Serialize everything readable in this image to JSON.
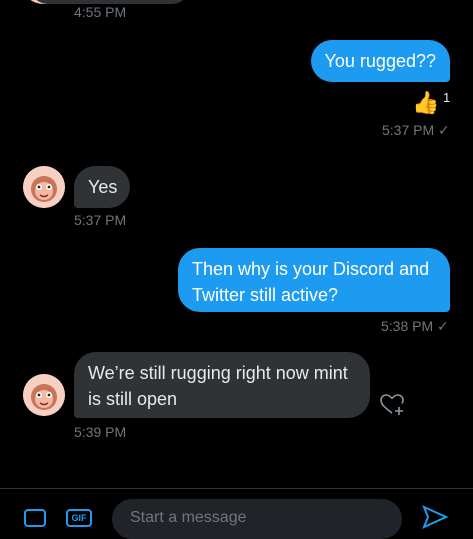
{
  "messages": [
    {
      "kind": "time_only",
      "time": "4:55 PM"
    },
    {
      "kind": "sent",
      "text": "You rugged??",
      "reaction": {
        "emoji": "👍",
        "count": "1"
      },
      "time": "5:37 PM",
      "check": "✓"
    },
    {
      "kind": "received",
      "text": "Yes",
      "time": "5:37 PM"
    },
    {
      "kind": "sent",
      "text": "Then why is your Discord and Twitter still active?",
      "time": "5:38 PM",
      "check": "✓"
    },
    {
      "kind": "received",
      "text": "We’re still rugging right now mint is still open",
      "time": "5:39 PM"
    }
  ],
  "composer": {
    "placeholder": "Start a message",
    "gif_label": "GIF"
  },
  "colors": {
    "background": "#000000",
    "sent_bubble": "#1d9bf0",
    "received_bubble": "#2f3336",
    "muted_text": "#71767b"
  },
  "icons": [
    "image-icon",
    "gif-icon",
    "send-icon",
    "add-reaction-icon",
    "checkmark-icon",
    "avatar"
  ]
}
